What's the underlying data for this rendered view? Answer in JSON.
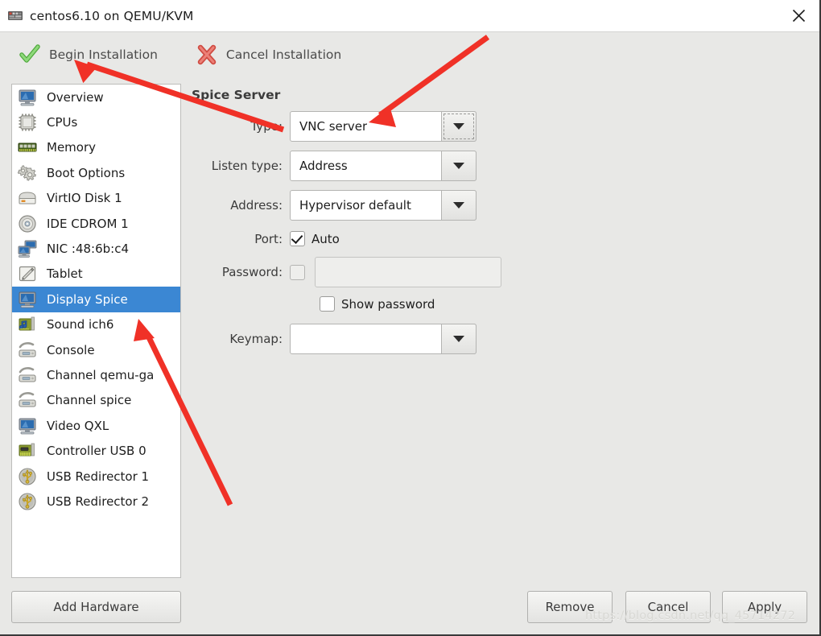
{
  "window": {
    "title": "centos6.10 on QEMU/KVM",
    "title_icon": "vm-icon",
    "close_icon": "close-icon"
  },
  "toolbar": {
    "begin_label": "Begin Installation",
    "begin_icon": "green-check-icon",
    "cancel_label": "Cancel Installation",
    "cancel_icon": "red-x-icon"
  },
  "sidebar": {
    "items": [
      {
        "label": "Overview",
        "icon": "monitor-icon",
        "selected": false
      },
      {
        "label": "CPUs",
        "icon": "cpu-chip-icon",
        "selected": false
      },
      {
        "label": "Memory",
        "icon": "ram-stick-icon",
        "selected": false
      },
      {
        "label": "Boot Options",
        "icon": "gears-icon",
        "selected": false
      },
      {
        "label": "VirtIO Disk 1",
        "icon": "harddisk-icon",
        "selected": false
      },
      {
        "label": "IDE CDROM 1",
        "icon": "cdrom-icon",
        "selected": false
      },
      {
        "label": "NIC :48:6b:c4",
        "icon": "network-icon",
        "selected": false
      },
      {
        "label": "Tablet",
        "icon": "tablet-pen-icon",
        "selected": false
      },
      {
        "label": "Display Spice",
        "icon": "monitor-icon",
        "selected": true
      },
      {
        "label": "Sound ich6",
        "icon": "sound-card-icon",
        "selected": false
      },
      {
        "label": "Console",
        "icon": "console-icon",
        "selected": false
      },
      {
        "label": "Channel qemu-ga",
        "icon": "console-icon",
        "selected": false
      },
      {
        "label": "Channel spice",
        "icon": "console-icon",
        "selected": false
      },
      {
        "label": "Video QXL",
        "icon": "monitor-icon",
        "selected": false
      },
      {
        "label": "Controller USB 0",
        "icon": "controller-card-icon",
        "selected": false
      },
      {
        "label": "USB Redirector 1",
        "icon": "usb-icon",
        "selected": false
      },
      {
        "label": "USB Redirector 2",
        "icon": "usb-icon",
        "selected": false
      }
    ]
  },
  "main": {
    "section_title": "Spice Server",
    "type": {
      "label": "Type:",
      "value": "VNC server",
      "focused": true
    },
    "listen_type": {
      "label": "Listen type:",
      "value": "Address"
    },
    "address": {
      "label": "Address:",
      "value": "Hypervisor default"
    },
    "port": {
      "label": "Port:",
      "checkbox_label": "Auto",
      "checked": true
    },
    "password": {
      "label": "Password:",
      "checked": false,
      "value": "",
      "enabled": false
    },
    "show_password": {
      "label": "Show password",
      "checked": false
    },
    "keymap": {
      "label": "Keymap:",
      "value": ""
    }
  },
  "bottom": {
    "add_hardware": "Add Hardware",
    "remove": "Remove",
    "cancel": "Cancel",
    "apply": "Apply"
  },
  "watermark": "https://blog.csdn.net/qq_45714272",
  "colors": {
    "selection_blue": "#3b87d3",
    "window_bg": "#e8e8e6",
    "annotation_red": "#f03127"
  }
}
